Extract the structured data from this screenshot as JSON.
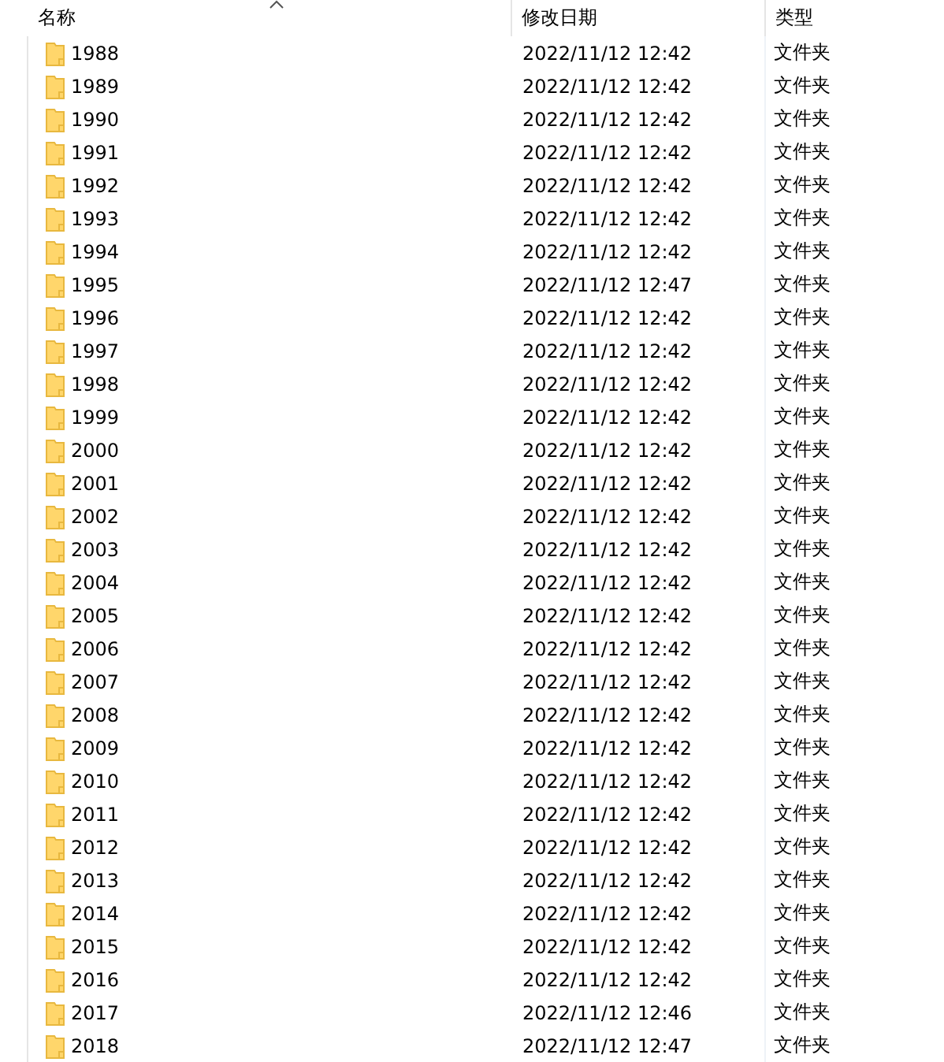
{
  "columns": [
    {
      "label": "名称",
      "sorted": true
    },
    {
      "label": "修改日期",
      "sorted": false
    },
    {
      "label": "类型",
      "sorted": false
    }
  ],
  "rows": [
    {
      "name": "1988",
      "modified": "2022/11/12 12:42",
      "type": "文件夹"
    },
    {
      "name": "1989",
      "modified": "2022/11/12 12:42",
      "type": "文件夹"
    },
    {
      "name": "1990",
      "modified": "2022/11/12 12:42",
      "type": "文件夹"
    },
    {
      "name": "1991",
      "modified": "2022/11/12 12:42",
      "type": "文件夹"
    },
    {
      "name": "1992",
      "modified": "2022/11/12 12:42",
      "type": "文件夹"
    },
    {
      "name": "1993",
      "modified": "2022/11/12 12:42",
      "type": "文件夹"
    },
    {
      "name": "1994",
      "modified": "2022/11/12 12:42",
      "type": "文件夹"
    },
    {
      "name": "1995",
      "modified": "2022/11/12 12:47",
      "type": "文件夹"
    },
    {
      "name": "1996",
      "modified": "2022/11/12 12:42",
      "type": "文件夹"
    },
    {
      "name": "1997",
      "modified": "2022/11/12 12:42",
      "type": "文件夹"
    },
    {
      "name": "1998",
      "modified": "2022/11/12 12:42",
      "type": "文件夹"
    },
    {
      "name": "1999",
      "modified": "2022/11/12 12:42",
      "type": "文件夹"
    },
    {
      "name": "2000",
      "modified": "2022/11/12 12:42",
      "type": "文件夹"
    },
    {
      "name": "2001",
      "modified": "2022/11/12 12:42",
      "type": "文件夹"
    },
    {
      "name": "2002",
      "modified": "2022/11/12 12:42",
      "type": "文件夹"
    },
    {
      "name": "2003",
      "modified": "2022/11/12 12:42",
      "type": "文件夹"
    },
    {
      "name": "2004",
      "modified": "2022/11/12 12:42",
      "type": "文件夹"
    },
    {
      "name": "2005",
      "modified": "2022/11/12 12:42",
      "type": "文件夹"
    },
    {
      "name": "2006",
      "modified": "2022/11/12 12:42",
      "type": "文件夹"
    },
    {
      "name": "2007",
      "modified": "2022/11/12 12:42",
      "type": "文件夹"
    },
    {
      "name": "2008",
      "modified": "2022/11/12 12:42",
      "type": "文件夹"
    },
    {
      "name": "2009",
      "modified": "2022/11/12 12:42",
      "type": "文件夹"
    },
    {
      "name": "2010",
      "modified": "2022/11/12 12:42",
      "type": "文件夹"
    },
    {
      "name": "2011",
      "modified": "2022/11/12 12:42",
      "type": "文件夹"
    },
    {
      "name": "2012",
      "modified": "2022/11/12 12:42",
      "type": "文件夹"
    },
    {
      "name": "2013",
      "modified": "2022/11/12 12:42",
      "type": "文件夹"
    },
    {
      "name": "2014",
      "modified": "2022/11/12 12:42",
      "type": "文件夹"
    },
    {
      "name": "2015",
      "modified": "2022/11/12 12:42",
      "type": "文件夹"
    },
    {
      "name": "2016",
      "modified": "2022/11/12 12:42",
      "type": "文件夹"
    },
    {
      "name": "2017",
      "modified": "2022/11/12 12:46",
      "type": "文件夹"
    },
    {
      "name": "2018",
      "modified": "2022/11/12 12:47",
      "type": "文件夹"
    }
  ]
}
